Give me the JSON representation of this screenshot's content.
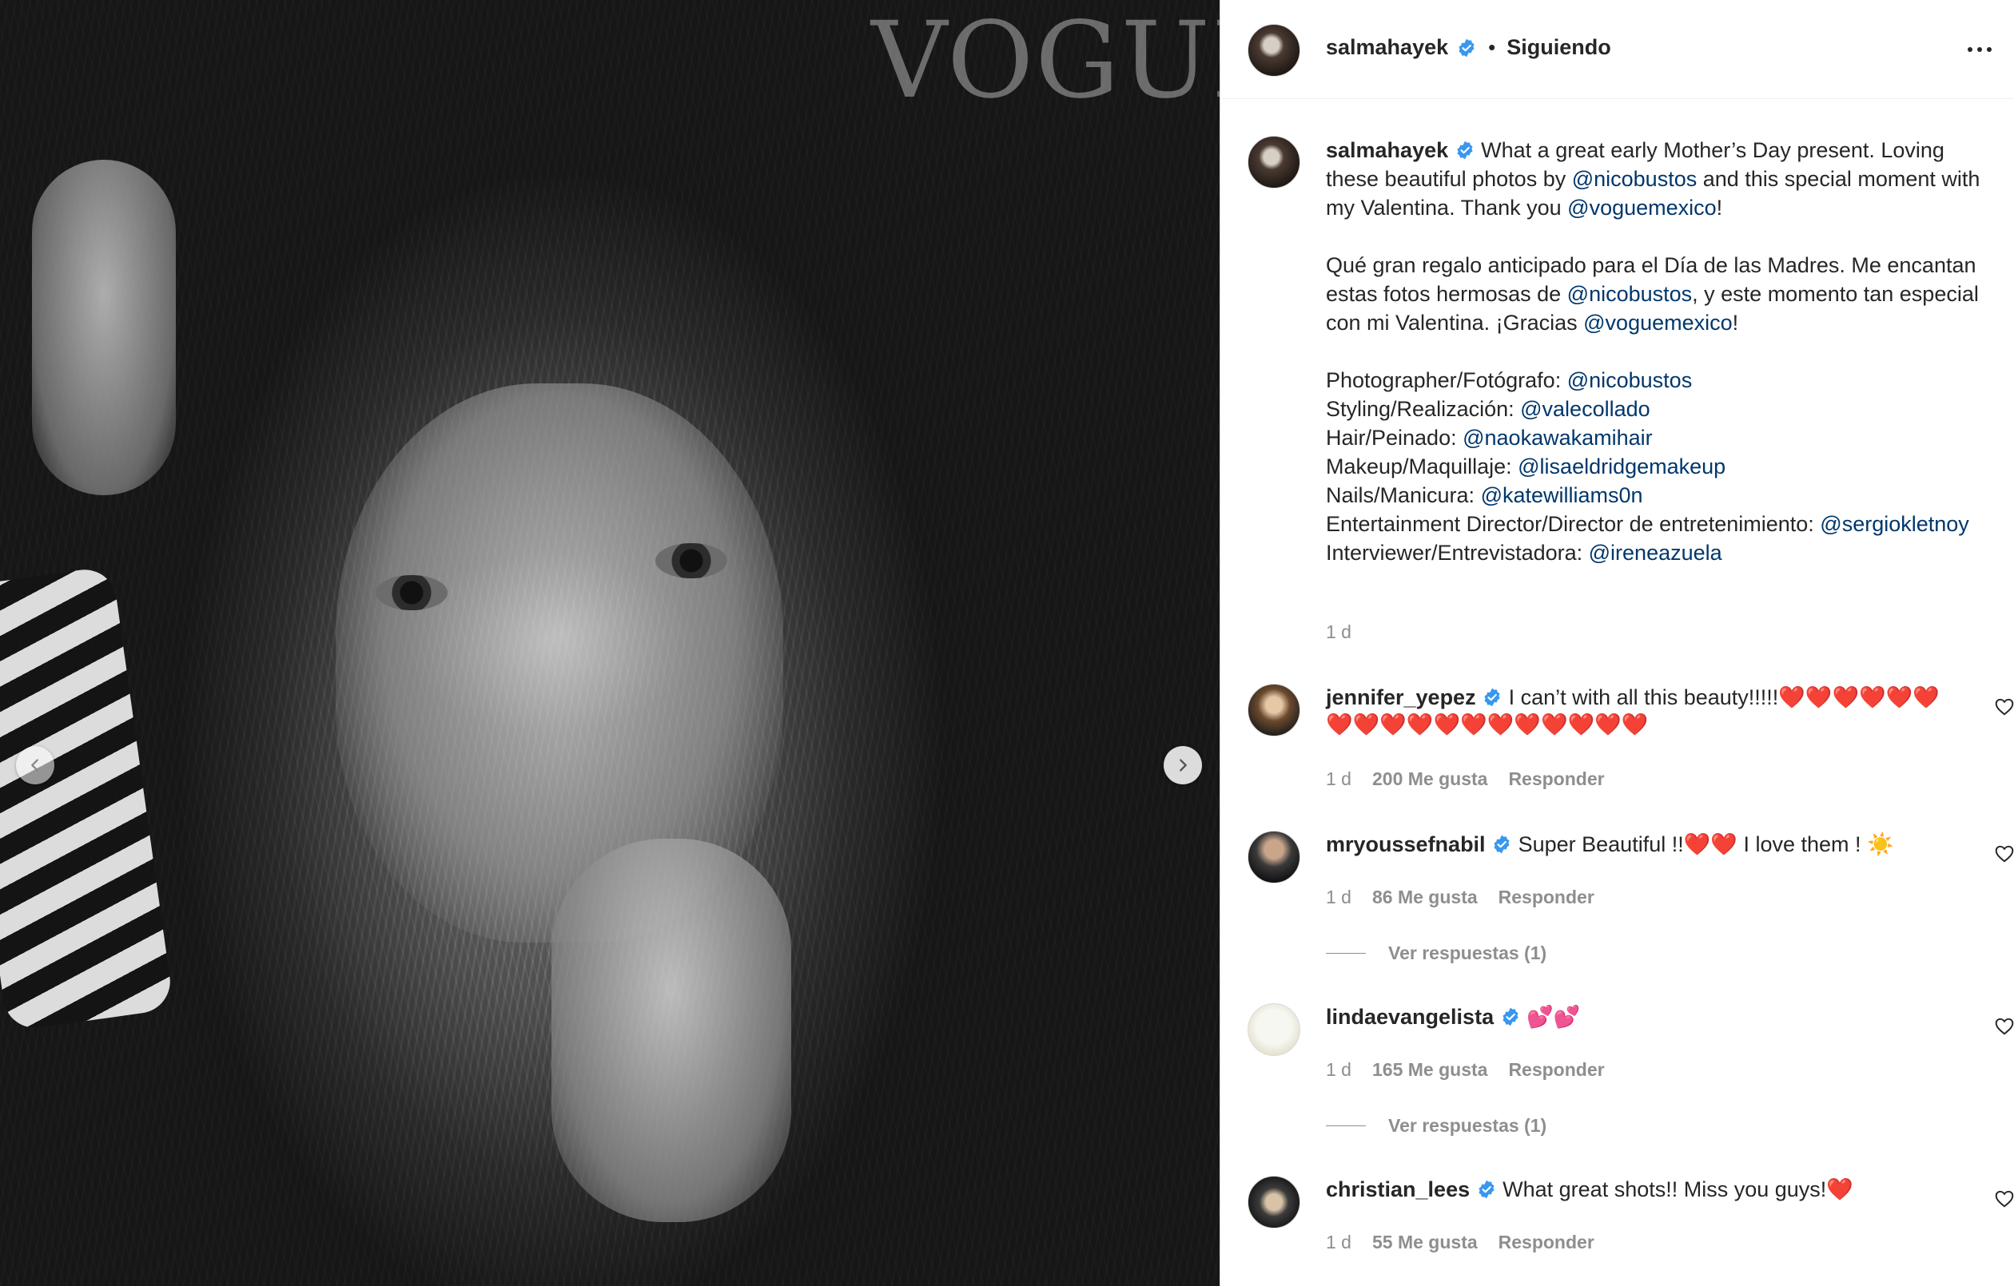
{
  "media": {
    "watermark": "VOGUE"
  },
  "header": {
    "username": "salmahayek",
    "separator": "•",
    "follow_state": "Siguiendo"
  },
  "caption": {
    "username": "salmahayek",
    "p1_a": "What a great early Mother’s Day present. Loving these beautiful photos by ",
    "p1_m1": "@nicobustos",
    "p1_b": " and this special moment with my Valentina. Thank you ",
    "p1_m2": "@voguemexico",
    "p1_c": "!",
    "p2_a": "Qué gran regalo anticipado para el Día de las Madres. Me encantan estas fotos hermosas de ",
    "p2_m1": "@nicobustos",
    "p2_b": ", y este momento tan especial con mi Valentina. ¡Gracias ",
    "p2_m2": "@voguemexico",
    "p2_c": "!",
    "credits": [
      {
        "label": "Photographer/Fotógrafo: ",
        "mention": "@nicobustos"
      },
      {
        "label": "Styling/Realización: ",
        "mention": "@valecollado"
      },
      {
        "label": "Hair/Peinado: ",
        "mention": "@naokawakamihair"
      },
      {
        "label": "Makeup/Maquillaje: ",
        "mention": "@lisaeldridgemakeup"
      },
      {
        "label": "Nails/Manicura: ",
        "mention": "@katewilliams0n"
      },
      {
        "label": "Entertainment Director/Director de entretenimiento: ",
        "mention": "@sergiokletnoy"
      },
      {
        "label": "Interviewer/Entrevistadora: ",
        "mention": "@ireneazuela"
      }
    ],
    "time": "1 d"
  },
  "comments": [
    {
      "username": "jennifer_yepez",
      "text": "I can’t with all this beauty!!!!!",
      "emoji": "❤️❤️❤️❤️❤️❤️❤️❤️❤️❤️❤️❤️❤️❤️❤️❤️❤️❤️",
      "time": "1 d",
      "likes": "200 Me gusta",
      "reply": "Responder"
    },
    {
      "username": "mryoussefnabil",
      "text": "Super Beautiful !!",
      "emoji": "❤️❤️",
      "text2": " I love them ! ",
      "emoji2": "☀️",
      "time": "1 d",
      "likes": "86 Me gusta",
      "reply": "Responder",
      "view_replies": "Ver respuestas (1)"
    },
    {
      "username": "lindaevangelista",
      "text": "",
      "emoji": "💕💕",
      "time": "1 d",
      "likes": "165 Me gusta",
      "reply": "Responder",
      "view_replies": "Ver respuestas (1)"
    },
    {
      "username": "christian_lees",
      "text": "What great shots!! Miss you guys!",
      "emoji": "❤️",
      "time": "1 d",
      "likes": "55 Me gusta",
      "reply": "Responder"
    }
  ],
  "colors": {
    "verified": "#3897f0",
    "mention": "#00376b",
    "muted": "#8e8e8e",
    "text": "#262626"
  },
  "icons": {
    "verified": "verified-badge-icon",
    "more": "more-options-icon",
    "heart": "heart-outline-icon",
    "prev": "chevron-left-icon",
    "next": "chevron-right-icon"
  }
}
